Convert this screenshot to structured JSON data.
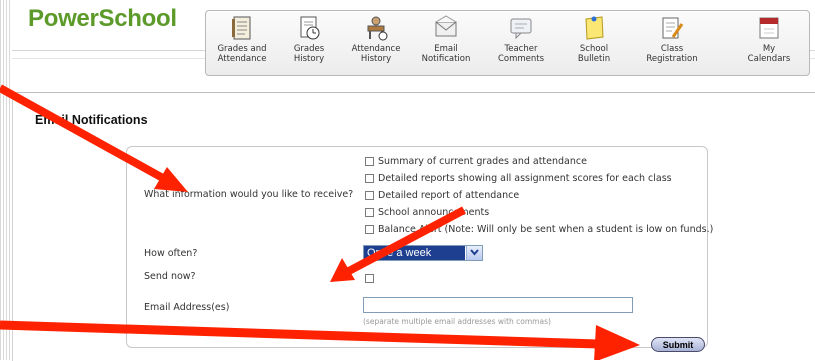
{
  "app": {
    "logo_text": "PowerSchool"
  },
  "nav": {
    "items": [
      {
        "id": "grades-attendance",
        "label": "Grades and\nAttendance",
        "icon": "gradebook-icon"
      },
      {
        "id": "grades-history",
        "label": "Grades\nHistory",
        "icon": "clock-document-icon"
      },
      {
        "id": "attendance-history",
        "label": "Attendance\nHistory",
        "icon": "attendance-desk-icon"
      },
      {
        "id": "email-notification",
        "label": "Email\nNotification",
        "icon": "envelope-icon"
      },
      {
        "id": "teacher-comments",
        "label": "Teacher\nComments",
        "icon": "comment-icon"
      },
      {
        "id": "school-bulletin",
        "label": "School\nBulletin",
        "icon": "sticky-note-icon"
      },
      {
        "id": "class-registration",
        "label": "Class\nRegistration",
        "icon": "notepad-pencil-icon"
      },
      {
        "id": "my-calendars",
        "label": "My\nCalendars",
        "icon": "calendar-icon"
      }
    ]
  },
  "page": {
    "title": "Email Notifications"
  },
  "form": {
    "info_question": "What information would you like to receive?",
    "options": [
      "Summary of current grades and attendance",
      "Detailed reports showing all assignment scores for each class",
      "Detailed report of attendance",
      "School announcements",
      "Balance Alert (Note: Will only be sent when a student is low on funds.)"
    ],
    "frequency_label": "How often?",
    "frequency_value": "Once a week",
    "send_now_label": "Send now?",
    "email_label": "Email Address(es)",
    "email_value": "",
    "email_hint": "(separate multiple email addresses with commas)",
    "submit_label": "Submit"
  },
  "annotations": {
    "arrow_color": "#ff2200"
  },
  "colors": {
    "logo": "#5c9a2a",
    "select_highlight": "#1e3f8f"
  }
}
